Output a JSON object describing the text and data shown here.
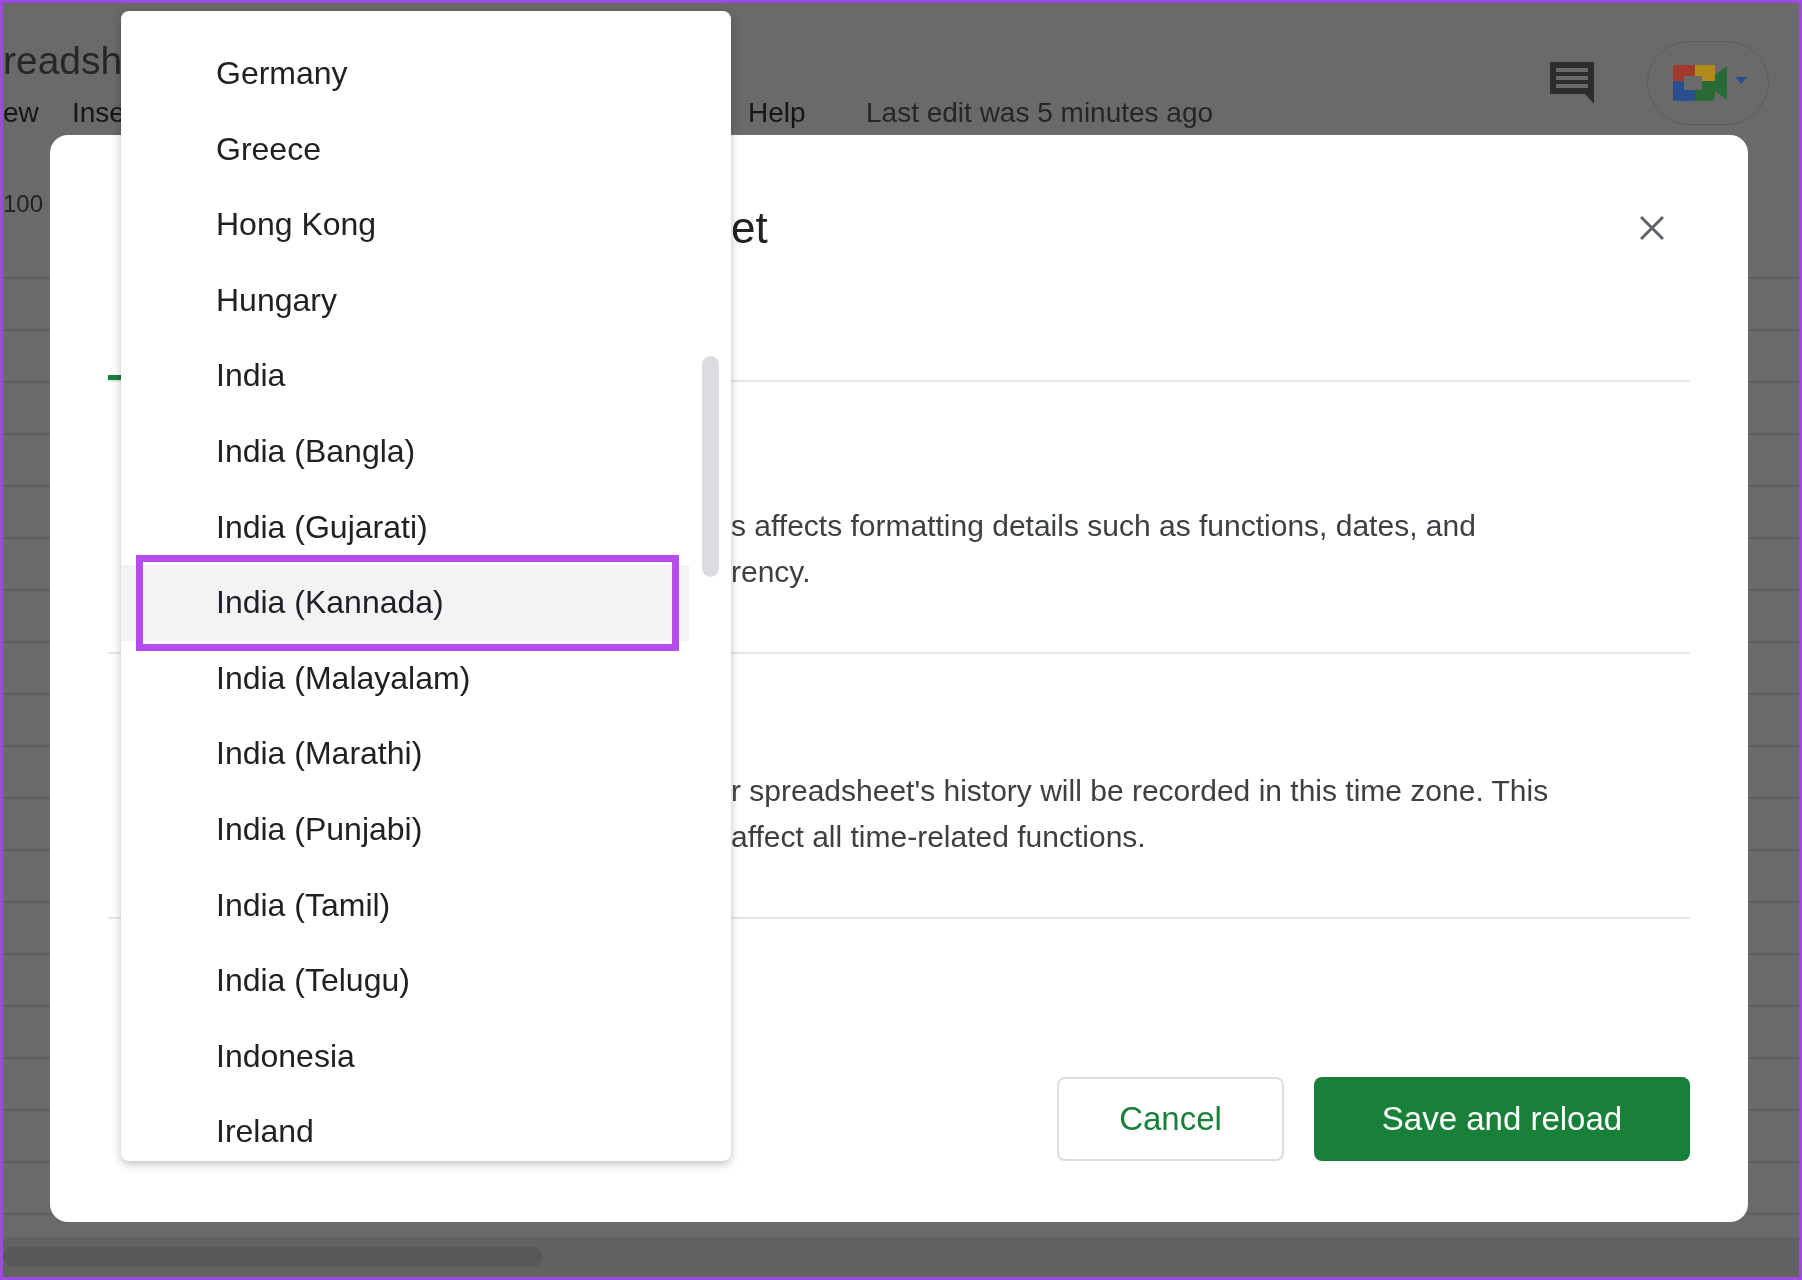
{
  "app": {
    "title": "readsh",
    "menu": [
      "ew",
      "Inse",
      "Help"
    ],
    "last_edit": "Last edit was 5 minutes ago",
    "zoom": "100"
  },
  "dialog": {
    "title": "et",
    "sections": [
      {
        "text": "s affects formatting details such as functions, dates, and\nrency."
      },
      {
        "text": "r spreadsheet's history will be recorded in this time zone. This\naffect all time-related functions."
      }
    ],
    "buttons": [
      {
        "label": "Cancel",
        "kind": "secondary"
      },
      {
        "label": "Save and reload",
        "kind": "primary"
      }
    ]
  },
  "dropdown": {
    "items": [
      {
        "label": "Germany",
        "selected": false
      },
      {
        "label": "Greece",
        "selected": false
      },
      {
        "label": "Hong Kong",
        "selected": false
      },
      {
        "label": "Hungary",
        "selected": false
      },
      {
        "label": "India",
        "selected": false
      },
      {
        "label": "India (Bangla)",
        "selected": false
      },
      {
        "label": "India (Gujarati)",
        "selected": false
      },
      {
        "label": "India (Kannada)",
        "selected": true
      },
      {
        "label": "India (Malayalam)",
        "selected": false
      },
      {
        "label": "India (Marathi)",
        "selected": false
      },
      {
        "label": "India (Punjabi)",
        "selected": false
      },
      {
        "label": "India (Tamil)",
        "selected": false
      },
      {
        "label": "India (Telugu)",
        "selected": false
      },
      {
        "label": "Indonesia",
        "selected": false
      },
      {
        "label": "Ireland",
        "selected": false
      }
    ]
  }
}
